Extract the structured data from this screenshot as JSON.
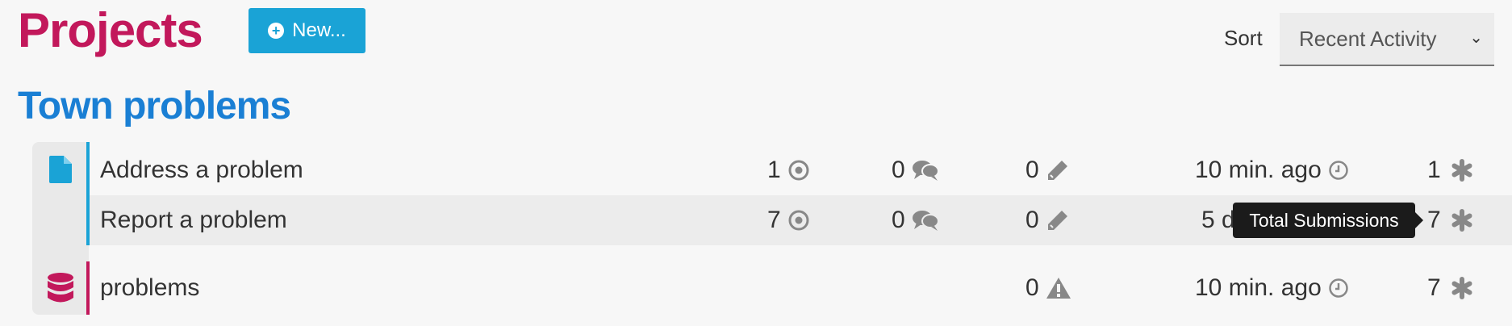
{
  "header": {
    "title": "Projects",
    "new_button_label": "New...",
    "new_button_icon": "plus-circle-icon"
  },
  "sort": {
    "label": "Sort",
    "selected": "Recent Activity"
  },
  "group": {
    "title": "Town problems",
    "forms": [
      {
        "name": "Address a problem",
        "assigned": "1",
        "comments": "0",
        "edits": "0",
        "last_activity": "10 min. ago",
        "total_submissions": "1"
      },
      {
        "name": "Report a problem",
        "assigned": "7",
        "comments": "0",
        "edits": "0",
        "last_activity": "5 days ago",
        "total_submissions": "7"
      }
    ],
    "dataset": {
      "name": "problems",
      "conflicts": "0",
      "last_activity": "10 min. ago",
      "entities": "7"
    }
  },
  "tooltip": {
    "text": "Total Submissions"
  },
  "colors": {
    "brand_magenta": "#c2185b",
    "link_blue": "#1a7fd4",
    "button_blue": "#1aa3d6",
    "icon_gray": "#888888"
  }
}
